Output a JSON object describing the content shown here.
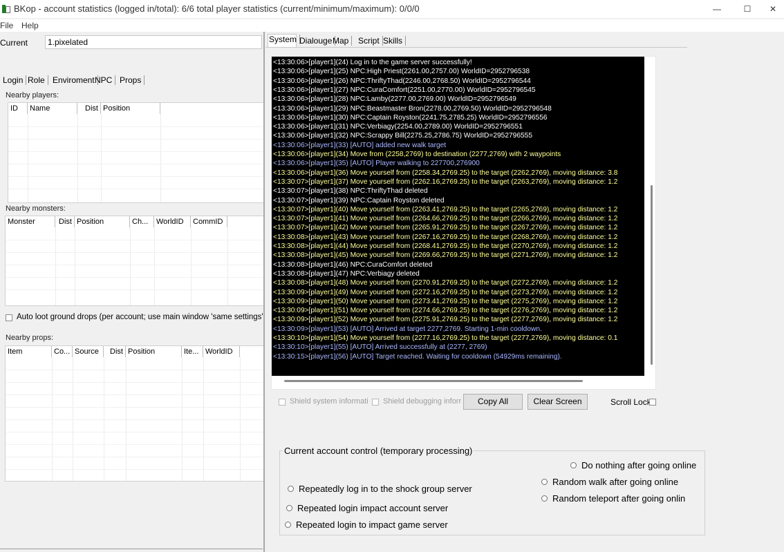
{
  "window": {
    "title": "BKop - account statistics (logged in/total): 6/6 total player statistics (current/minimum/maximum): 0/0/0",
    "controls": [
      "—",
      "☐",
      "✕"
    ]
  },
  "menu": [
    "File",
    "Help"
  ],
  "left": {
    "current_label": "Current",
    "current_value": "1.pixelated",
    "tabs": [
      "Login",
      "Role",
      "Enviroment",
      "NPC",
      "Props"
    ],
    "nearby_players": {
      "label": "Nearby players:",
      "columns": [
        "ID",
        "Name",
        "Dist",
        "Position"
      ]
    },
    "nearby_monsters": {
      "label": "Nearby monsters:",
      "columns": [
        "Monster",
        "Dist",
        "Position",
        "Ch...",
        "WorldID",
        "CommID"
      ]
    },
    "auto_loot_label": "Auto loot ground drops (per account; use main window 'same settings' to ap",
    "nearby_props": {
      "label": "Nearby props:",
      "columns": [
        "Item",
        "Co...",
        "Source",
        "Dist",
        "Position",
        "Ite...",
        "WorldID"
      ]
    }
  },
  "right": {
    "tabs": [
      "System",
      "Dialouge",
      "Map",
      "Script",
      "Skills"
    ],
    "log": [
      {
        "text": "<13:30:06>[player1](24) Log in to the game server successfully!",
        "color": "#ffffff"
      },
      {
        "text": "<13:30:06>[player1](25) NPC:High Priest(2261.00,2757.00) WorldID=2952796538",
        "color": "#ffffff"
      },
      {
        "text": "<13:30:06>[player1](26) NPC:ThriftyThad(2246.00,2768.50) WorldID=2952796544",
        "color": "#ffffff"
      },
      {
        "text": "<13:30:06>[player1](27) NPC:CuraComfort(2251.00,2770.00) WorldID=2952796545",
        "color": "#ffffff"
      },
      {
        "text": "<13:30:06>[player1](28) NPC:Lamby(2277.00,2769.00) WorldID=2952796549",
        "color": "#ffffff"
      },
      {
        "text": "<13:30:06>[player1](29) NPC:Beastmaster Bron(2278.00,2769.50) WorldID=2952796548",
        "color": "#ffffff"
      },
      {
        "text": "<13:30:06>[player1](30) NPC:Captain Royston(2241.75,2785.25) WorldID=2952796556",
        "color": "#ffffff"
      },
      {
        "text": "<13:30:06>[player1](31) NPC:Verbiagy(2254.00,2789.00) WorldID=2952796551",
        "color": "#ffffff"
      },
      {
        "text": "<13:30:06>[player1](32) NPC:Scrappy Bill(2275.25,2786.75) WorldID=2952796555",
        "color": "#ffffff"
      },
      {
        "text": "<13:30:06>[player1](33) [AUTO] added new walk target",
        "color": "#aab7ff"
      },
      {
        "text": "<13:30:06>[player1](34) Move from (2258,2769) to destination (2277,2769) with 2 waypoints",
        "color": "#ffff9a"
      },
      {
        "text": "<13:30:06>[player1](35) [AUTO] Player walking to 227700,276900",
        "color": "#aab7ff"
      },
      {
        "text": "<13:30:06>[player1](36) Move yourself from (2258.34,2769.25) to the target (2262,2769), moving distance: 3.8",
        "color": "#ffff9a"
      },
      {
        "text": "<13:30:07>[player1](37) Move yourself from (2262.16,2769.25) to the target (2263,2769), moving distance: 1.2",
        "color": "#ffff9a"
      },
      {
        "text": "<13:30:07>[player1](38) NPC:ThriftyThad deleted",
        "color": "#ffffff"
      },
      {
        "text": "<13:30:07>[player1](39) NPC:Captain Royston deleted",
        "color": "#ffffff"
      },
      {
        "text": "<13:30:07>[player1](40) Move yourself from (2263.41,2769.25) to the target (2265,2769), moving distance: 1.2",
        "color": "#ffff9a"
      },
      {
        "text": "<13:30:07>[player1](41) Move yourself from (2264.66,2769.25) to the target (2266,2769), moving distance: 1.2",
        "color": "#ffff9a"
      },
      {
        "text": "<13:30:07>[player1](42) Move yourself from (2265.91,2769.25) to the target (2267,2769), moving distance: 1.2",
        "color": "#ffff9a"
      },
      {
        "text": "<13:30:08>[player1](43) Move yourself from (2267.16,2769.25) to the target (2268,2769), moving distance: 1.2",
        "color": "#ffff9a"
      },
      {
        "text": "<13:30:08>[player1](44) Move yourself from (2268.41,2769.25) to the target (2270,2769), moving distance: 1.2",
        "color": "#ffff9a"
      },
      {
        "text": "<13:30:08>[player1](45) Move yourself from (2269.66,2769.25) to the target (2271,2769), moving distance: 1.2",
        "color": "#ffff9a"
      },
      {
        "text": "<13:30:08>[player1](46) NPC:CuraComfort deleted",
        "color": "#ffffff"
      },
      {
        "text": "<13:30:08>[player1](47) NPC:Verbiagy deleted",
        "color": "#ffffff"
      },
      {
        "text": "<13:30:08>[player1](48) Move yourself from (2270.91,2769.25) to the target (2272,2769), moving distance: 1.2",
        "color": "#ffff9a"
      },
      {
        "text": "<13:30:09>[player1](49) Move yourself from (2272.16,2769.25) to the target (2273,2769), moving distance: 1.2",
        "color": "#ffff9a"
      },
      {
        "text": "<13:30:09>[player1](50) Move yourself from (2273.41,2769.25) to the target (2275,2769), moving distance: 1.2",
        "color": "#ffff9a"
      },
      {
        "text": "<13:30:09>[player1](51) Move yourself from (2274.66,2769.25) to the target (2276,2769), moving distance: 1.2",
        "color": "#ffff9a"
      },
      {
        "text": "<13:30:09>[player1](52) Move yourself from (2275.91,2769.25) to the target (2277,2769), moving distance: 1.2",
        "color": "#ffff9a"
      },
      {
        "text": "<13:30:09>[player1](53) [AUTO] Arrived at target 2277,2769. Starting 1-min cooldown.",
        "color": "#aab7ff"
      },
      {
        "text": "<13:30:10>[player1](54) Move yourself from (2277.16,2769.25) to the target (2277,2769), moving distance: 0.1",
        "color": "#ffff9a"
      },
      {
        "text": "<13:30:10>[player1](55) [AUTO] Arrived successfully at (2277, 2769)",
        "color": "#aab7ff"
      },
      {
        "text": "<13:30:15>[player1](56) [AUTO] Target reached. Waiting for cooldown (54929ms remaining).",
        "color": "#aab7ff"
      }
    ],
    "shield_system": "Shield system informati",
    "shield_debug": "Shield debugging inforr",
    "copy_all": "Copy All",
    "clear_screen": "Clear Screen",
    "scroll_lock": "Scroll Lock",
    "control_group": {
      "title": "Current account control (temporary processing)",
      "left_options": [
        "Repeatedly log in to the shock group server",
        "Repeated login impact account server",
        "Repeated login to impact game server"
      ],
      "right_options": [
        "Do nothing after going online",
        "Random walk after going online",
        "Random teleport after going onlin"
      ]
    }
  }
}
